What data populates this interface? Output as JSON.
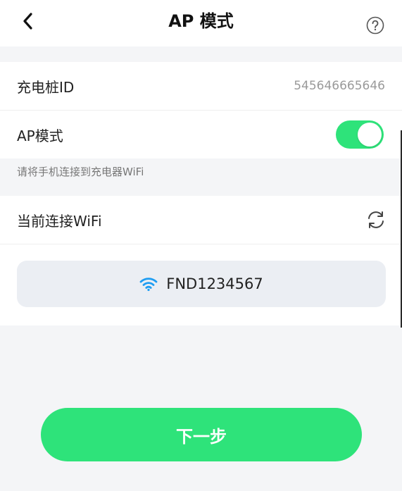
{
  "header": {
    "title": "AP 模式"
  },
  "charger": {
    "id_label": "充电桩ID",
    "id_value": "545646665646"
  },
  "ap_mode": {
    "label": "AP模式",
    "enabled": true
  },
  "hint_text": "请将手机连接到充电器WiFi",
  "current_wifi": {
    "label": "当前连接WiFi",
    "ssid": "FND1234567"
  },
  "actions": {
    "next_label": "下一步"
  },
  "colors": {
    "accent": "#2ee37a",
    "wifi_icon": "#1e9df2"
  }
}
